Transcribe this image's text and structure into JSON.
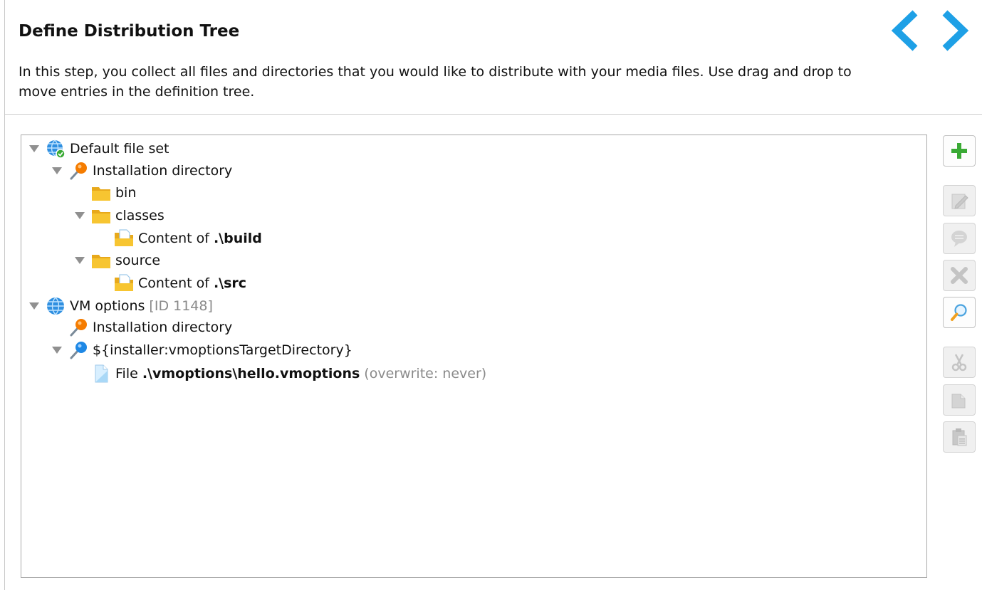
{
  "header": {
    "title": "Define Distribution Tree",
    "description": "In this step, you collect all files and directories that you would like to distribute with your media files. Use drag and drop to move entries in the definition tree."
  },
  "tree": {
    "default_file_set": {
      "label": "Default file set"
    },
    "installation_dir_1": {
      "label": "Installation directory"
    },
    "bin": {
      "label": "bin"
    },
    "classes": {
      "label": "classes"
    },
    "content_build": {
      "prefix": "Content of ",
      "path": ".\\build"
    },
    "source": {
      "label": "source"
    },
    "content_src": {
      "prefix": "Content of ",
      "path": ".\\src"
    },
    "vm_options": {
      "label": "VM options",
      "id": "[ID 1148]"
    },
    "installation_dir_2": {
      "label": "Installation directory"
    },
    "target_dir": {
      "label": "${installer:vmoptionsTargetDirectory}"
    },
    "file_entry": {
      "prefix": "File ",
      "path": ".\\vmoptions\\hello.vmoptions",
      "suffix": "(overwrite: never)"
    }
  },
  "colors": {
    "accent_blue": "#1ea0e6",
    "folder_yellow": "#f7c531",
    "add_green": "#3aaa35",
    "pin_orange": "#f57c00",
    "pin_blue": "#1e88e5"
  }
}
